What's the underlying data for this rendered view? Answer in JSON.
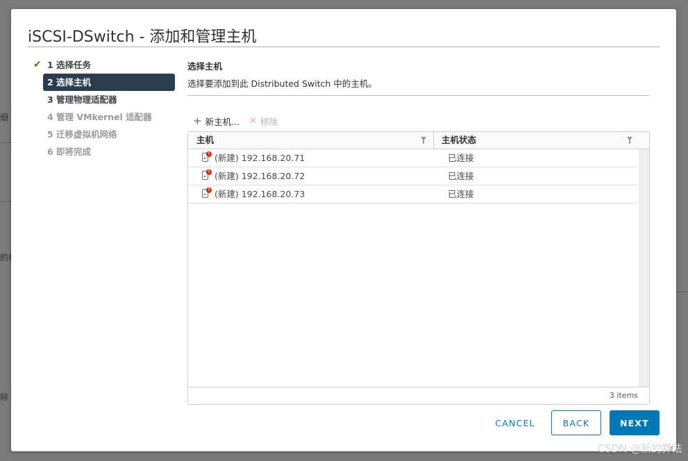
{
  "background": {
    "fragments": [
      "细",
      "的标",
      "除"
    ]
  },
  "dialog": {
    "title": "iSCSI-DSwitch - 添加和管理主机"
  },
  "steps": [
    {
      "label": "1 选择任务",
      "state": "done"
    },
    {
      "label": "2 选择主机",
      "state": "active"
    },
    {
      "label": "3 管理物理适配器",
      "state": "next"
    },
    {
      "label": "4 管理 VMkernel 适配器",
      "state": "disabled"
    },
    {
      "label": "5 迁移虚拟机网络",
      "state": "disabled"
    },
    {
      "label": "6 即将完成",
      "state": "disabled"
    }
  ],
  "section": {
    "title": "选择主机",
    "description": "选择要添加到此 Distributed Switch 中的主机。"
  },
  "toolbar": {
    "add_label": "新主机...",
    "remove_label": "移除"
  },
  "grid": {
    "columns": [
      "主机",
      "主机状态"
    ],
    "rows": [
      {
        "host": "(新建) 192.168.20.71",
        "state": "已连接"
      },
      {
        "host": "(新建) 192.168.20.72",
        "state": "已连接"
      },
      {
        "host": "(新建) 192.168.20.73",
        "state": "已连接"
      }
    ],
    "footer_count": "3 items"
  },
  "buttons": {
    "cancel": "CANCEL",
    "back": "BACK",
    "next": "NEXT"
  },
  "watermark": "CSDN @新的算法",
  "colors": {
    "accent": "#0079b8",
    "active_step_bg": "#2b3e50",
    "check": "#318700",
    "alert": "#e62700"
  }
}
